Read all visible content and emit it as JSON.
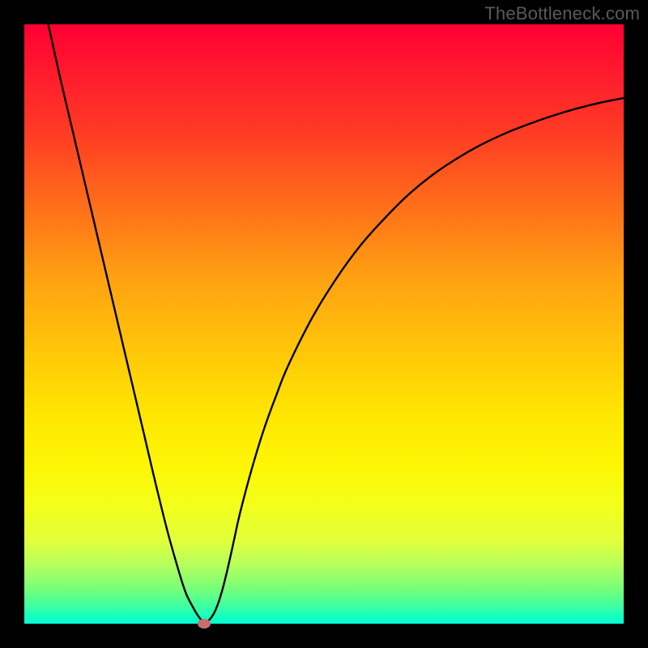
{
  "watermark": "TheBottleneck.com",
  "chart_data": {
    "type": "line",
    "title": "",
    "xlabel": "",
    "ylabel": "",
    "xlim": [
      0,
      100
    ],
    "ylim": [
      0,
      100
    ],
    "grid": false,
    "legend": false,
    "series": [
      {
        "name": "curve",
        "color": "#000000",
        "x": [
          4,
          6,
          8,
          10,
          12,
          14,
          16,
          18,
          20,
          22,
          24,
          26,
          27,
          28,
          29,
          30,
          31,
          32,
          33,
          34,
          35,
          36,
          38,
          40,
          42,
          44,
          48,
          52,
          56,
          60,
          64,
          68,
          72,
          76,
          80,
          84,
          88,
          92,
          96,
          100
        ],
        "y": [
          100,
          91,
          82.5,
          74,
          65.5,
          57,
          48.5,
          40,
          31.5,
          23,
          15,
          8,
          5,
          3,
          1.3,
          0.3,
          0.8,
          2.5,
          5.5,
          9.5,
          14,
          18.5,
          26,
          32.5,
          38,
          43,
          51,
          57.5,
          63,
          67.5,
          71.5,
          74.8,
          77.5,
          79.8,
          81.7,
          83.3,
          84.7,
          85.9,
          86.9,
          87.7
        ]
      }
    ],
    "annotations": [
      {
        "name": "min-marker",
        "x": 30,
        "y": 0,
        "color": "#cb6d6d"
      }
    ],
    "background_gradient": {
      "type": "vertical",
      "stops": [
        {
          "pos": 0,
          "color": "#ff0033"
        },
        {
          "pos": 50,
          "color": "#ffc808"
        },
        {
          "pos": 80,
          "color": "#f3ff1a"
        },
        {
          "pos": 100,
          "color": "#07fbd2"
        }
      ]
    }
  }
}
